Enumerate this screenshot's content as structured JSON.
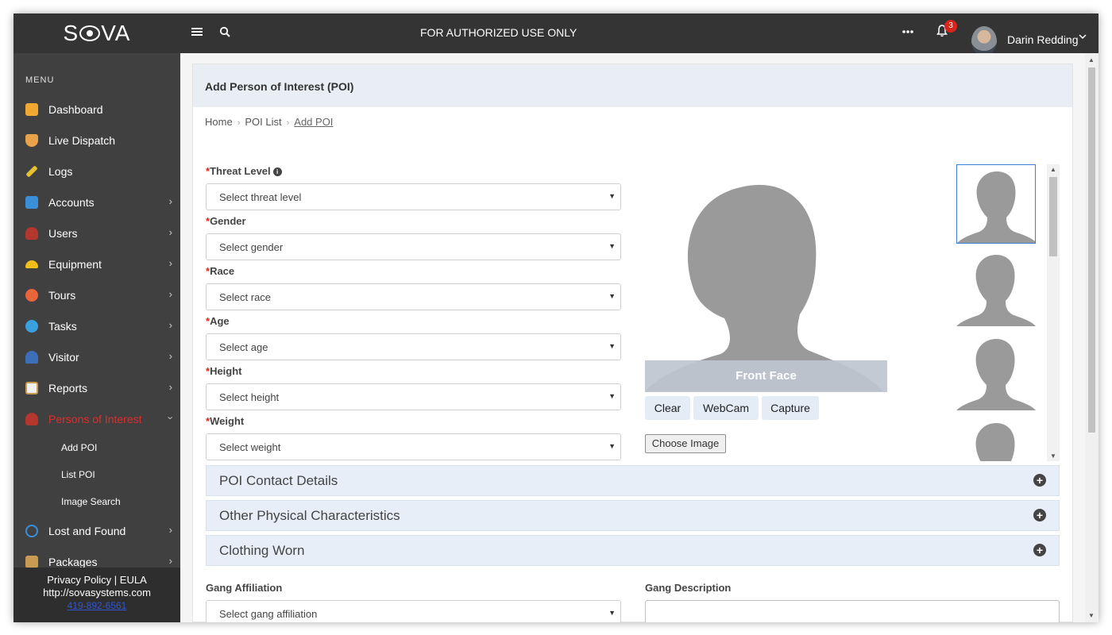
{
  "brand": {
    "logo_text_left": "S",
    "logo_text_right": "VA"
  },
  "topbar": {
    "banner": "FOR AUTHORIZED USE ONLY",
    "notification_count": "3",
    "user_name": "Darin Redding"
  },
  "sidebar": {
    "menu_title": "MENU",
    "items": [
      {
        "label": "Dashboard",
        "icon": "home-icon",
        "color": "#f0a830"
      },
      {
        "label": "Live Dispatch",
        "icon": "shield-icon",
        "color": "#e8a34a"
      },
      {
        "label": "Logs",
        "icon": "pencil-icon",
        "color": "#e6c02e"
      },
      {
        "label": "Accounts",
        "icon": "building-icon",
        "color": "#3a8fd8"
      },
      {
        "label": "Users",
        "icon": "user-icon",
        "color": "#b3372c"
      },
      {
        "label": "Equipment",
        "icon": "helmet-icon",
        "color": "#f2c018"
      },
      {
        "label": "Tours",
        "icon": "compass-icon",
        "color": "#e8663a"
      },
      {
        "label": "Tasks",
        "icon": "cog-icon",
        "color": "#3aa0e0"
      },
      {
        "label": "Visitor",
        "icon": "visitor-icon",
        "color": "#3c6fb8"
      },
      {
        "label": "Reports",
        "icon": "clipboard-icon",
        "color": "#f0f0f0"
      },
      {
        "label": "Persons of Interest",
        "icon": "person-icon",
        "color": "#b3372c"
      },
      {
        "label": "Lost and Found",
        "icon": "target-icon",
        "color": "#3a8fd8"
      },
      {
        "label": "Packages",
        "icon": "package-icon",
        "color": "#c99a52"
      }
    ],
    "sub_items": [
      "Add POI",
      "List POI",
      "Image Search"
    ],
    "footer": {
      "links": "Privacy Policy | EULA",
      "url": "http://sovasystems.com",
      "phone": "419-892-6561"
    }
  },
  "page": {
    "title": "Add Person of Interest (POI)",
    "breadcrumb": [
      "Home",
      "POI List",
      "Add POI"
    ]
  },
  "form": {
    "fields": [
      {
        "label": "Threat Level",
        "placeholder": "Select threat level"
      },
      {
        "label": "Gender",
        "placeholder": "Select gender"
      },
      {
        "label": "Race",
        "placeholder": "Select race"
      },
      {
        "label": "Age",
        "placeholder": "Select age"
      },
      {
        "label": "Height",
        "placeholder": "Select height"
      },
      {
        "label": "Weight",
        "placeholder": "Select weight"
      }
    ],
    "photo": {
      "front_label": "Front Face",
      "buttons": [
        "Clear",
        "WebCam",
        "Capture"
      ],
      "choose_label": "Choose Image"
    },
    "accordions": [
      "POI Contact Details",
      "Other Physical Characteristics",
      "Clothing Worn"
    ],
    "gang_affiliation_label": "Gang Affiliation",
    "gang_affiliation_placeholder": "Select gang affiliation",
    "gang_description_label": "Gang Description"
  }
}
